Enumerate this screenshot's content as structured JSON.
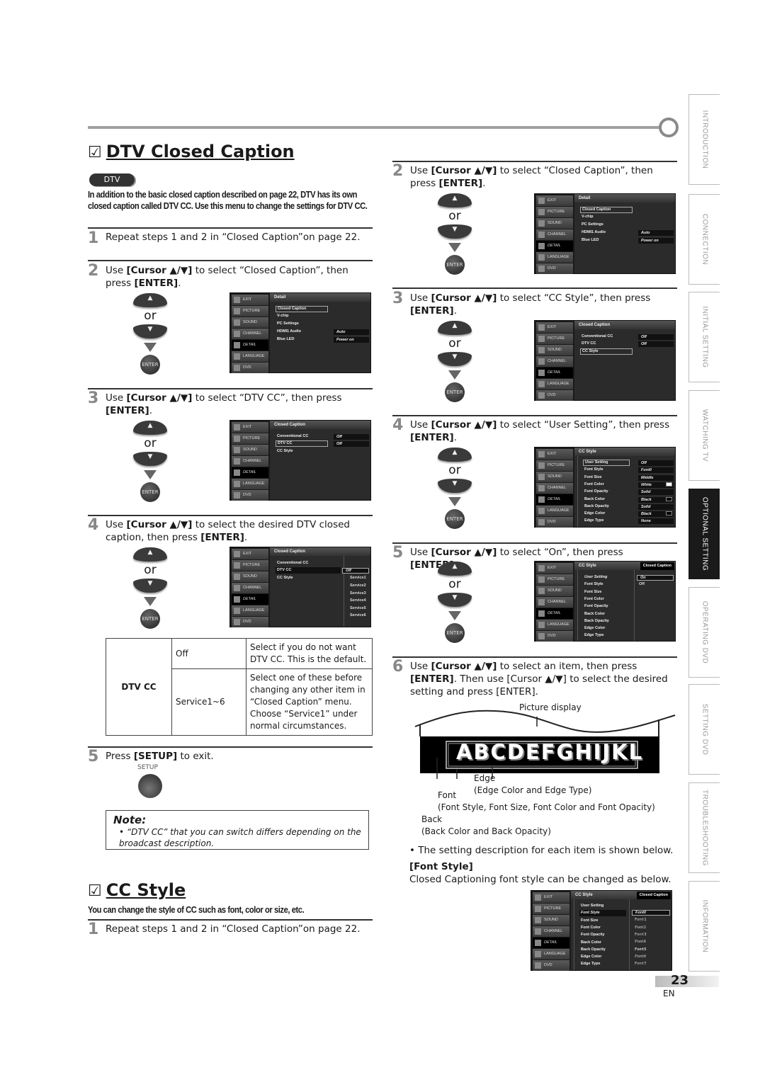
{
  "dtv_closed_caption": {
    "title": "DTV Closed Caption",
    "check_glyph": "☑",
    "badge": "DTV",
    "intro": "In addition to the basic closed caption described on page 22, DTV has its own closed caption called DTV CC. Use this menu to change the settings for DTV CC.",
    "steps": [
      {
        "num": "1",
        "text": "Repeat steps 1 and 2 in “Closed Caption”on page 22."
      },
      {
        "num": "2",
        "pre": "Use ",
        "b1": "[Cursor ▲/▼]",
        "mid": " to select “Closed Caption”, then press ",
        "b2": "[ENTER]",
        "post": "."
      },
      {
        "num": "3",
        "pre": "Use ",
        "b1": "[Cursor ▲/▼]",
        "mid": " to select “DTV CC”, then press ",
        "b2": "[ENTER]",
        "post": "."
      },
      {
        "num": "4",
        "pre": "Use ",
        "b1": "[Cursor ▲/▼]",
        "mid": " to select the desired DTV closed caption, then press ",
        "b2": "[ENTER]",
        "post": "."
      },
      {
        "num": "5",
        "pre": "Press ",
        "b1": "[SETUP]",
        "mid": " to exit.",
        "b2": "",
        "post": ""
      }
    ],
    "table": {
      "label": "DTV CC",
      "rows": [
        {
          "option": "Off",
          "desc": "Select if you do not want DTV CC. This is the default."
        },
        {
          "option": "Service1~6",
          "desc": "Select one of these before changing any other item in “Closed Caption” menu. Choose “Service1” under normal circumstances."
        }
      ]
    },
    "setup_label": "SETUP",
    "note": {
      "title": "Note:",
      "text": "• “DTV CC” that you can switch differs depending on the broadcast description."
    }
  },
  "cc_style": {
    "title": "CC Style",
    "check_glyph": "☑",
    "intro": "You can change the style of CC such as font, color or size, etc.",
    "steps": [
      {
        "num": "1",
        "text": "Repeat steps 1 and 2 in “Closed Caption”on page 22."
      },
      {
        "num": "2",
        "pre": "Use ",
        "b1": "[Cursor ▲/▼]",
        "mid": " to select “Closed Caption”, then press ",
        "b2": "[ENTER]",
        "post": "."
      },
      {
        "num": "3",
        "pre": "Use ",
        "b1": "[Cursor ▲/▼]",
        "mid": " to select “CC Style”, then press ",
        "b2": "[ENTER]",
        "post": "."
      },
      {
        "num": "4",
        "pre": "Use ",
        "b1": "[Cursor ▲/▼]",
        "mid": " to select “User Setting”, then press ",
        "b2": "[ENTER]",
        "post": "."
      },
      {
        "num": "5",
        "pre": "Use ",
        "b1": "[Cursor ▲/▼]",
        "mid": " to select “On”, then press ",
        "b2": "[ENTER]",
        "post": "."
      },
      {
        "num": "6",
        "pre": "Use ",
        "b1": "[Cursor ▲/▼]",
        "mid": " to select an item, then press ",
        "b2": "[ENTER]",
        "post": ". Then use [Cursor ▲/▼] to select the desired setting and press [ENTER]."
      }
    ],
    "diagram": {
      "picture_display": "Picture display",
      "sample": "ABCDEFGHIJKL",
      "edge": "Edge",
      "edge_desc": "(Edge Color and Edge Type)",
      "font": "Font",
      "font_desc": "(Font Style, Font Size, Font Color and Font Opacity)",
      "back": "Back",
      "back_desc": "(Back Color and Back Opacity)"
    },
    "bullet": "• The setting description for each item is shown below.",
    "font_style_heading": "[Font Style]",
    "font_style_text": "Closed Captioning font style can be changed as below."
  },
  "remote": {
    "or": "or",
    "up": "▲",
    "down": "▼",
    "enter": "ENTER"
  },
  "tv_menu": {
    "side_items": [
      "EXIT",
      "PICTURE",
      "SOUND",
      "CHANNEL",
      "DETAIL",
      "LANGUAGE",
      "DVD"
    ],
    "detail": {
      "header": "Detail",
      "items": [
        "Closed Caption",
        "V-chip",
        "PC Settings",
        "HDMI1 Audio",
        "Blue LED"
      ],
      "values": {
        "hdmi1_audio": "Auto",
        "blue_led": "Power on"
      }
    },
    "closed_caption": {
      "header": "Closed Caption",
      "items": [
        "Conventional CC",
        "DTV CC",
        "CC Style"
      ],
      "values": {
        "conventional_cc": "Off",
        "dtv_cc": "Off"
      },
      "dtv_options": [
        "Off",
        "Service1",
        "Service2",
        "Service3",
        "Service4",
        "Service5",
        "Service6"
      ]
    },
    "cc_style": {
      "header": "CC Style",
      "badge": "Closed Caption",
      "items": [
        "User Setting",
        "Font Style",
        "Font Size",
        "Font Color",
        "Font Opacity",
        "Back Color",
        "Back Opacity",
        "Edge Color",
        "Edge Type"
      ],
      "values": [
        "Off",
        "Font0",
        "Middle",
        "White",
        "Solid",
        "Black",
        "Solid",
        "Black",
        "None"
      ],
      "user_setting_options": [
        "On",
        "Off"
      ],
      "font_options": [
        "Font0",
        "Font1",
        "Font2",
        "Font3",
        "Font4",
        "Font5",
        "Font6",
        "Font7"
      ],
      "swatch_colors": {
        "white": "#ffffff",
        "black": "#000000"
      }
    }
  },
  "sidebar_tabs": [
    "INTRODUCTION",
    "CONNECTION",
    "INITIAL SETTING",
    "WATCHING TV",
    "OPTIONAL SETTING",
    "OPERATING DVD",
    "SETTING DVD",
    "TROUBLESHOOTING",
    "INFORMATION"
  ],
  "active_tab": "OPTIONAL SETTING",
  "page": {
    "number": "23",
    "lang": "EN"
  }
}
